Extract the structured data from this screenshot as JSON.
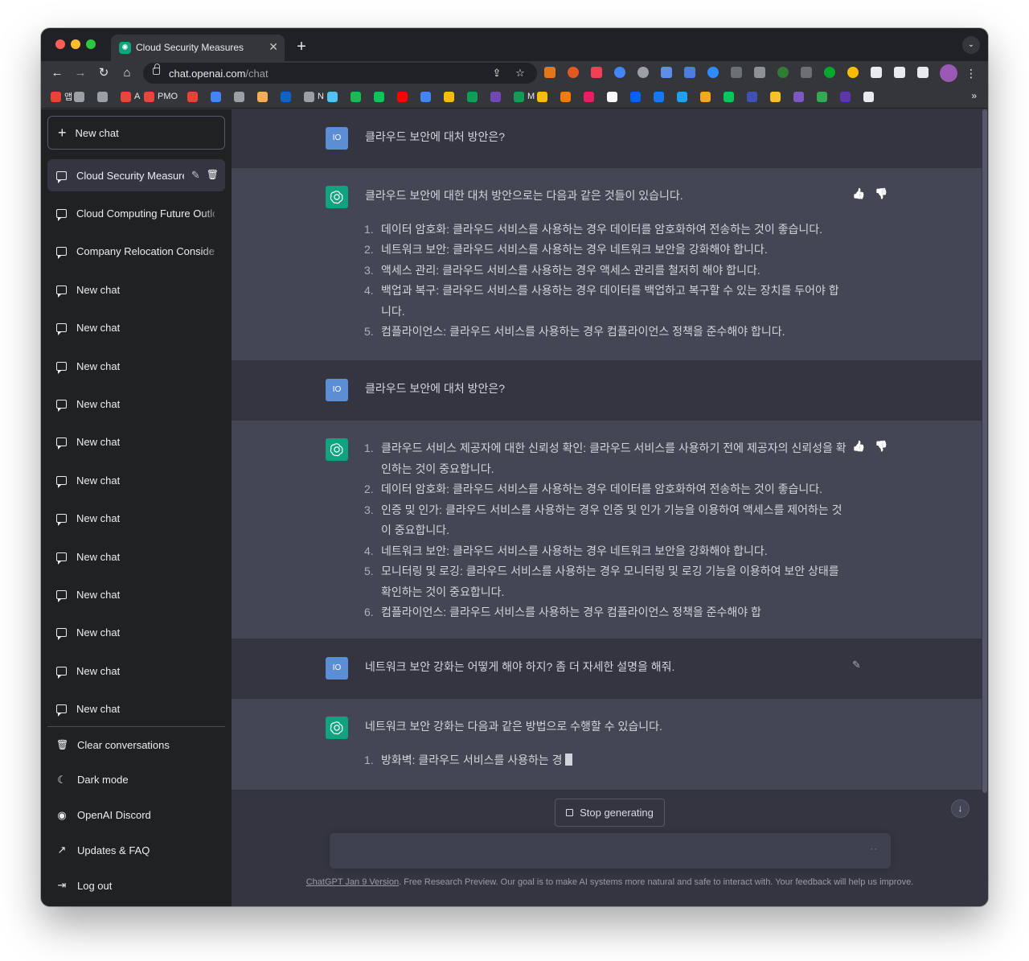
{
  "browser": {
    "tab_title": "Cloud Security Measures",
    "url_host": "chat.openai.com",
    "url_path": "/chat",
    "new_tab_label": "+",
    "tab_close": "✕",
    "bookmarks": [
      {
        "label": "앱",
        "icon": "apps-grid-icon",
        "color": "#ea4335"
      },
      {
        "label": "",
        "icon": "star-icon",
        "color": "#9aa0a6"
      },
      {
        "label": "",
        "icon": "history-icon",
        "color": "#9aa0a6"
      },
      {
        "label": "A",
        "icon": "bookmark-red-icon",
        "color": "#e8453c"
      },
      {
        "label": "PMO",
        "icon": "bookmark-red-icon",
        "color": "#e8453c"
      },
      {
        "label": "",
        "icon": "gmail-icon",
        "color": "#ea4335"
      },
      {
        "label": "",
        "icon": "calendar-icon",
        "color": "#4285f4"
      },
      {
        "label": "",
        "icon": "globe-icon",
        "color": "#9aa0a6"
      },
      {
        "label": "",
        "icon": "bookmark-orange-icon",
        "color": "#f6ad55"
      },
      {
        "label": "",
        "icon": "linkedin-icon",
        "color": "#0a66c2"
      },
      {
        "label": "N",
        "icon": "folder-icon",
        "color": "#9aa0a6"
      },
      {
        "label": "",
        "icon": "bookmark-blue-icon",
        "color": "#4fc3f7"
      },
      {
        "label": "",
        "icon": "bookmark-green-icon",
        "color": "#1db954"
      },
      {
        "label": "",
        "icon": "naver-icon",
        "color": "#03c75a"
      },
      {
        "label": "",
        "icon": "youtube-icon",
        "color": "#ff0000"
      },
      {
        "label": "",
        "icon": "docs-icon",
        "color": "#4285f4"
      },
      {
        "label": "",
        "icon": "slides-icon",
        "color": "#fbbc04"
      },
      {
        "label": "",
        "icon": "sheets-icon",
        "color": "#0f9d58"
      },
      {
        "label": "",
        "icon": "forms-icon",
        "color": "#7248b9"
      },
      {
        "label": "M",
        "icon": "sheets-icon",
        "color": "#0f9d58"
      },
      {
        "label": "",
        "icon": "drive-icon",
        "color": "#fbbc04"
      },
      {
        "label": "",
        "icon": "bookmark-orange-icon",
        "color": "#f57c00"
      },
      {
        "label": "",
        "icon": "pinwheel-icon",
        "color": "#e91e63"
      },
      {
        "label": "",
        "icon": "amazon-icon",
        "color": "#ffffff"
      },
      {
        "label": "",
        "icon": "dropbox-icon",
        "color": "#0061fe"
      },
      {
        "label": "",
        "icon": "facebook-icon",
        "color": "#1877f2"
      },
      {
        "label": "",
        "icon": "twitter-icon",
        "color": "#1da1f2"
      },
      {
        "label": "",
        "icon": "bookmark-d-icon",
        "color": "#f5a623"
      },
      {
        "label": "",
        "icon": "naver-icon",
        "color": "#03c75a"
      },
      {
        "label": "",
        "icon": "bookmark-blue-icon",
        "color": "#3f51b5"
      },
      {
        "label": "",
        "icon": "bookmark-yellow-icon",
        "color": "#fbc02d"
      },
      {
        "label": "",
        "icon": "bookmark-purple-icon",
        "color": "#7e57c2"
      },
      {
        "label": "",
        "icon": "maps-icon",
        "color": "#34a853"
      },
      {
        "label": "",
        "icon": "bookmark-purple-icon",
        "color": "#5e35b1"
      },
      {
        "label": "",
        "icon": "more-icon",
        "color": "#e8eaed"
      }
    ],
    "bookmarks_more": "»"
  },
  "sidebar": {
    "new_chat_label": "New chat",
    "conversations": [
      {
        "label": "Cloud Security Measures",
        "active": true
      },
      {
        "label": "Cloud Computing Future Outlook",
        "active": false
      },
      {
        "label": "Company Relocation Considerations",
        "active": false
      },
      {
        "label": "New chat",
        "active": false
      },
      {
        "label": "New chat",
        "active": false
      },
      {
        "label": "New chat",
        "active": false
      },
      {
        "label": "New chat",
        "active": false
      },
      {
        "label": "New chat",
        "active": false
      },
      {
        "label": "New chat",
        "active": false
      },
      {
        "label": "New chat",
        "active": false
      },
      {
        "label": "New chat",
        "active": false
      },
      {
        "label": "New chat",
        "active": false
      },
      {
        "label": "New chat",
        "active": false
      },
      {
        "label": "New chat",
        "active": false
      },
      {
        "label": "New chat",
        "active": false
      }
    ],
    "footer": [
      {
        "label": "Clear conversations",
        "icon": "trash-icon"
      },
      {
        "label": "Dark mode",
        "icon": "moon-icon"
      },
      {
        "label": "OpenAI Discord",
        "icon": "discord-icon"
      },
      {
        "label": "Updates & FAQ",
        "icon": "external-link-icon"
      },
      {
        "label": "Log out",
        "icon": "logout-icon"
      }
    ]
  },
  "chat": {
    "user_initials": "IO",
    "messages": [
      {
        "role": "user",
        "text": "클라우드 보안에 대처 방안은?"
      },
      {
        "role": "assistant",
        "intro": "클라우드 보안에 대한 대처 방안으로는 다음과 같은 것들이 있습니다.",
        "items": [
          "데이터 암호화: 클라우드 서비스를 사용하는 경우 데이터를 암호화하여 전송하는 것이 좋습니다.",
          "네트워크 보안: 클라우드 서비스를 사용하는 경우 네트워크 보안을 강화해야 합니다.",
          "액세스 관리: 클라우드 서비스를 사용하는 경우 액세스 관리를 철저히 해야 합니다.",
          "백업과 복구: 클라우드 서비스를 사용하는 경우 데이터를 백업하고 복구할 수 있는 장치를 두어야 합니다.",
          "컴플라이언스: 클라우드 서비스를 사용하는 경우 컴플라이언스 정책을 준수해야 합니다."
        ]
      },
      {
        "role": "user",
        "text": "클라우드 보안에 대처 방안은?"
      },
      {
        "role": "assistant",
        "intro": "",
        "items": [
          "클라우드 서비스 제공자에 대한 신뢰성 확인: 클라우드 서비스를 사용하기 전에 제공자의 신뢰성을 확인하는 것이 중요합니다.",
          "데이터 암호화: 클라우드 서비스를 사용하는 경우 데이터를 암호화하여 전송하는 것이 좋습니다.",
          "인증 및 인가: 클라우드 서비스를 사용하는 경우 인증 및 인가 기능을 이용하여 액세스를 제어하는 것이 중요합니다.",
          "네트워크 보안: 클라우드 서비스를 사용하는 경우 네트워크 보안을 강화해야 합니다.",
          "모니터링 및 로깅: 클라우드 서비스를 사용하는 경우 모니터링 및 로깅 기능을 이용하여 보안 상태를 확인하는 것이 중요합니다.",
          "컴플라이언스: 클라우드 서비스를 사용하는 경우 컴플라이언스 정책을 준수해야 합"
        ]
      },
      {
        "role": "user",
        "text": "네트워크 보안 강화는 어떻게 해야 하지? 좀 더 자세한 설명을 해줘."
      },
      {
        "role": "assistant",
        "intro": "네트워크 보안 강화는 다음과 같은 방법으로 수행할 수 있습니다.",
        "items": [
          "방화벽: 클라우드 서비스를 사용하는 경"
        ]
      }
    ],
    "stop_label": "Stop generating",
    "input_placeholder": "",
    "typing_indicator": "··",
    "disclaimer_link": "ChatGPT Jan 9 Version",
    "disclaimer_text": ". Free Research Preview. Our goal is to make AI systems more natural and safe to interact with. Your feedback will help us improve."
  },
  "colors": {
    "sidebar_bg": "#202123",
    "user_bg": "#343541",
    "assistant_bg": "#444654",
    "accent": "#10a37f",
    "user_avatar": "#5b8ed4"
  }
}
